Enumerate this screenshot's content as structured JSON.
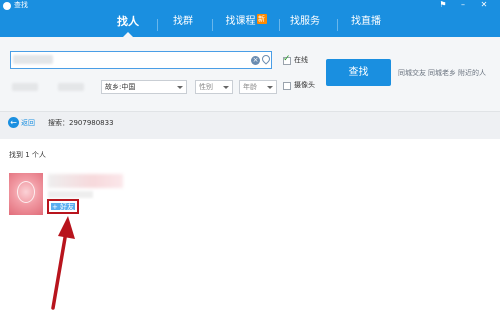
{
  "window": {
    "title": "查找",
    "controls": [
      "feedback-icon",
      "minimize-icon",
      "close-icon"
    ]
  },
  "tabs": [
    {
      "label": "找人",
      "active": true
    },
    {
      "label": "找群",
      "active": false
    },
    {
      "label": "找课程",
      "active": false,
      "badge": "新"
    },
    {
      "label": "找服务",
      "active": false
    },
    {
      "label": "找直播",
      "active": false
    }
  ],
  "search": {
    "value": "",
    "online_label": "在线",
    "online_checked": true,
    "camera_label": "摄像头",
    "camera_checked": false,
    "button_label": "查找",
    "quick_links": [
      "同城交友",
      "同城老乡",
      "附近的人"
    ],
    "hometown_select": "故乡:中国",
    "gender_select": "性别",
    "age_select": "年龄"
  },
  "results_bar": {
    "back_label": "返回",
    "query_text": "搜索：2907980833"
  },
  "results": {
    "count_text": "找到 1 个人",
    "add_friend_label": "+ 好友"
  },
  "colors": {
    "accent": "#1a8fe0",
    "annotation": "#b8141d"
  }
}
